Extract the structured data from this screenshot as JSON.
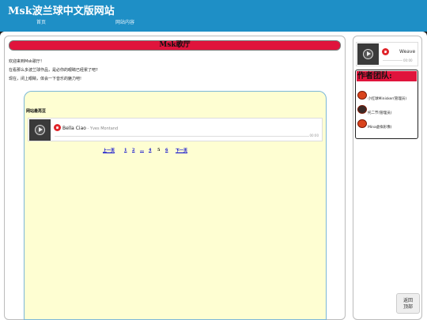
{
  "site": {
    "title": "Msk波兰球中文版网站"
  },
  "nav": [
    {
      "label": "首页"
    },
    {
      "label": "网站内容"
    }
  ],
  "main": {
    "title": "Msk歌厅",
    "intro": [
      "欢迎来到Msk歌厅！",
      "在看那么多波兰球作品，是必你的眼睛已经累了吧?",
      "现在，闭上眼睛，体会一下音乐的魅力吧!"
    ],
    "section_title": "网站最再豆",
    "player": {
      "song": "Bella Ciao",
      "artist": " - Yves Montand",
      "time": "00:00",
      "icon": "netease-music-icon"
    },
    "pager": {
      "prev": "上一页",
      "pages": [
        "1",
        "2",
        "…",
        "4",
        "5",
        "6"
      ],
      "next": "下一页"
    }
  },
  "sidebar": {
    "mini_player": {
      "song": "Weave",
      "time": "00:00",
      "icon": "netease-music-icon"
    },
    "team_title": "作者团队:",
    "members": [
      {
        "name": "小红球Minisker(管理员)"
      },
      {
        "name": "托二节(管理员)"
      },
      {
        "name": "Mina虚拟形像)"
      }
    ]
  },
  "back_to_top": {
    "line1": "返回",
    "line2": "顶部"
  },
  "colors": {
    "header": "#1e8fc6",
    "banner": "#e0143c",
    "panel": "#fefed2"
  }
}
